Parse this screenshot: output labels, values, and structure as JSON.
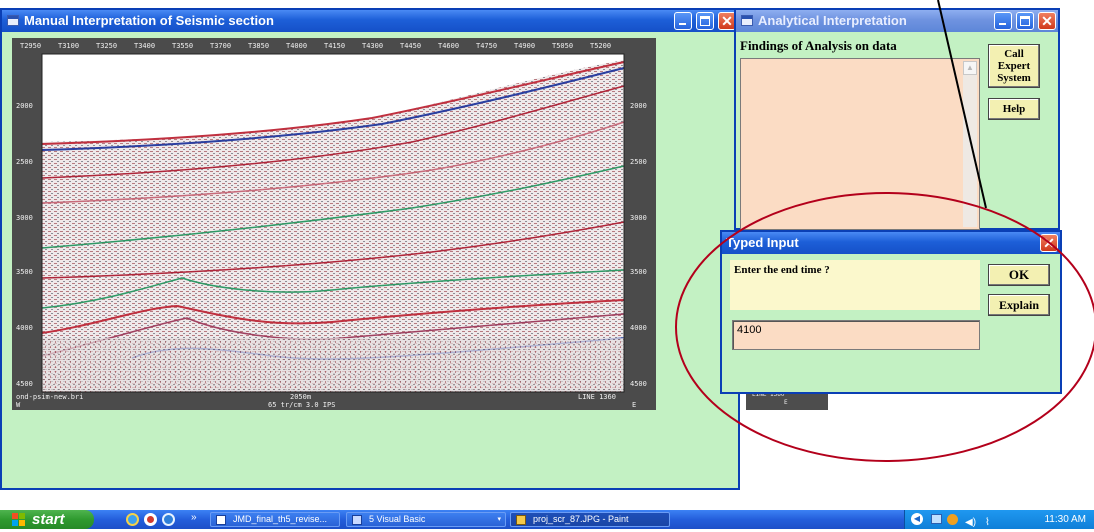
{
  "seismic_window": {
    "title": "Manual Interpretation of Seismic section",
    "top_ticks": [
      "T2950",
      "T3100",
      "T3250",
      "T3400",
      "T3550",
      "T3700",
      "T3850",
      "T4000",
      "T4150",
      "T4300",
      "T4450",
      "T4600",
      "T4750",
      "T4900",
      "T5050",
      "T5200"
    ],
    "depth_labels": [
      "2000",
      "2500",
      "3000",
      "3500",
      "4000",
      "4500"
    ],
    "right_depth_labels": [
      "2000",
      "2500",
      "3000",
      "3500",
      "4000",
      "4500"
    ],
    "bottom_left": "ond-psim-new.bri",
    "bottom_left2": "W",
    "bottom_center": "2050m",
    "bottom_center2": "65 tr/cm  3.0 IPS",
    "bottom_right": "LINE 1360",
    "bottom_right2": "E"
  },
  "analytical_window": {
    "title": "Analytical Interpretation",
    "findings_label": "Findings of Analysis on data",
    "call_expert_label": "Call Expert System",
    "help_label": "Help",
    "behind_label": "LINE 1360",
    "behind_label2": "E"
  },
  "typed_input": {
    "title": "Typed Input",
    "prompt": "Enter the end time ?",
    "ok_label": "OK",
    "explain_label": "Explain",
    "input_value": "4100"
  },
  "taskbar": {
    "start_label": "start",
    "more_label": "»",
    "buttons": [
      "JMD_final_th5_revise...",
      "5 Visual Basic",
      "proj_scr_87.JPG - Paint"
    ],
    "clock": "11:30 AM"
  },
  "colors": {
    "window_bg": "#c3f1c3",
    "findings_bg": "#fbdcc4",
    "prompt_bg": "#fbf8cc",
    "annotation": "#b3001b"
  }
}
